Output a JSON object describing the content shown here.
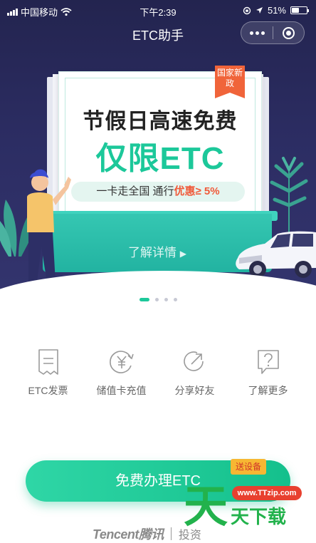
{
  "status_bar": {
    "carrier": "中国移动",
    "time": "下午2:39",
    "battery_level": "51%",
    "battery_fraction": 0.51
  },
  "nav": {
    "title": "ETC助手",
    "more_icon": "more-dots-icon",
    "close_icon": "mini-program-close-icon"
  },
  "banner": {
    "ribbon": "国家新政",
    "headline": "节假日高速免费",
    "subheadline": "仅限ETC",
    "tagline_prefix": "一卡走全国  通行",
    "tagline_highlight": "优惠≥ 5%",
    "detail_link": "了解详情",
    "carousel_count": 4,
    "carousel_active": 1
  },
  "actions": [
    {
      "label": "ETC发票",
      "icon": "receipt-icon"
    },
    {
      "label": "储值卡充值",
      "icon": "yuan-refresh-icon"
    },
    {
      "label": "分享好友",
      "icon": "share-arrow-icon"
    },
    {
      "label": "了解更多",
      "icon": "question-bubble-icon"
    }
  ],
  "cta": {
    "label": "免费办理ETC",
    "badge": "送设备"
  },
  "footer": {
    "brand": "Tencent腾讯",
    "sub": "投资"
  },
  "watermark": {
    "url": "www.TTzip.com",
    "text": "天天下载"
  },
  "colors": {
    "accent": "#1cc89a",
    "hero_bg": "#2a2b5f",
    "highlight": "#f05a3a"
  }
}
